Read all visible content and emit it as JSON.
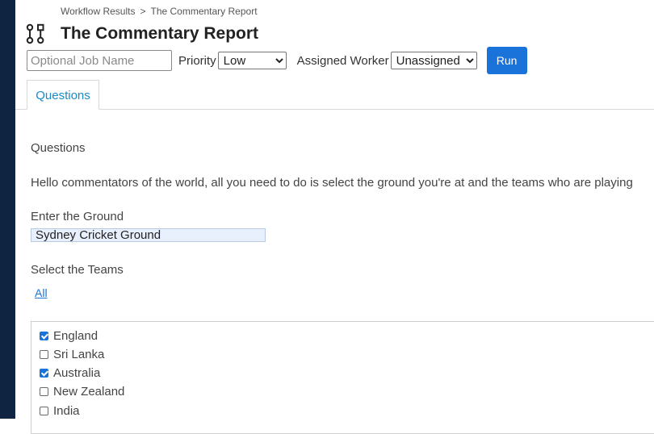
{
  "breadcrumb": {
    "parent": "Workflow Results",
    "separator": ">",
    "current": "The Commentary Report"
  },
  "page": {
    "title": "The Commentary Report"
  },
  "toolbar": {
    "job_name_placeholder": "Optional Job Name",
    "priority_label": "Priority",
    "priority_value": "Low",
    "worker_label": "Assigned Worker",
    "worker_value": "Unassigned",
    "run_label": "Run"
  },
  "tabs": [
    {
      "label": "Questions",
      "active": true
    }
  ],
  "questions": {
    "heading": "Questions",
    "intro": "Hello commentators of the world, all you need to do is select the ground you're at and the teams who are playing",
    "ground_label": "Enter the Ground",
    "ground_value": "Sydney Cricket Ground",
    "teams_label": "Select the Teams",
    "all_link": "All",
    "teams": [
      {
        "name": "England",
        "checked": true
      },
      {
        "name": "Sri Lanka",
        "checked": false
      },
      {
        "name": "Australia",
        "checked": true
      },
      {
        "name": "New Zealand",
        "checked": false
      },
      {
        "name": "India",
        "checked": false
      }
    ]
  },
  "colors": {
    "accent": "#1a73d9",
    "tab_text": "#1a8ac6",
    "rail": "#0f2440",
    "ground_bg": "#e8f0fe"
  },
  "icons": {
    "title": "workflow-icon"
  }
}
